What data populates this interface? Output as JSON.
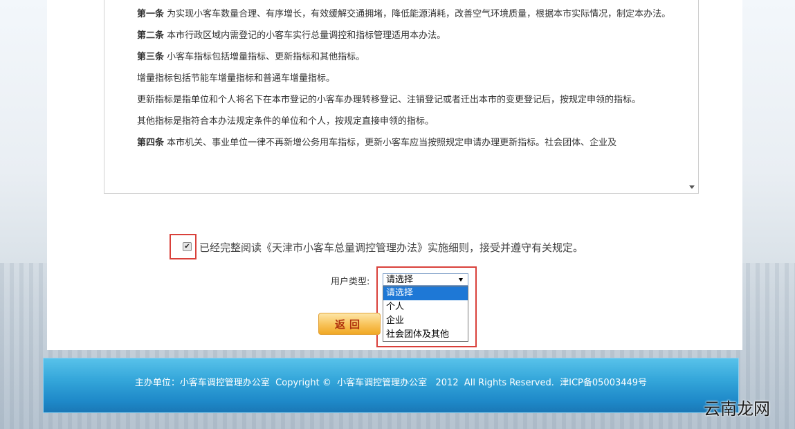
{
  "regulations": {
    "paragraphs": [
      {
        "lead": "第一条",
        "text": " 为实现小客车数量合理、有序增长，有效缓解交通拥堵，降低能源消耗，改善空气环境质量，根据本市实际情况，制定本办法。"
      },
      {
        "lead": "第二条",
        "text": " 本市行政区域内需登记的小客车实行总量调控和指标管理适用本办法。"
      },
      {
        "lead": "第三条",
        "text": " 小客车指标包括增量指标、更新指标和其他指标。"
      },
      {
        "lead": "",
        "text": "增量指标包括节能车增量指标和普通车增量指标。"
      },
      {
        "lead": "",
        "text": "更新指标是指单位和个人将名下在本市登记的小客车办理转移登记、注销登记或者迁出本市的变更登记后，按规定申领的指标。"
      },
      {
        "lead": "",
        "text": "其他指标是指符合本办法规定条件的单位和个人，按规定直接申领的指标。"
      },
      {
        "lead": "第四条",
        "text": " 本市机关、事业单位一律不再新增公务用车指标，更新小客车应当按照规定申请办理更新指标。社会团体、企业及"
      }
    ]
  },
  "agreement": {
    "checked": true,
    "check_glyph": "✔",
    "text": "已经完整阅读《天津市小客车总量调控管理办法》实施细则，接受并遵守有关规定。"
  },
  "user_type": {
    "label": "用户类型:",
    "selected": "请选择",
    "options": [
      "请选择",
      "个人",
      "企业",
      "社会团体及其他"
    ]
  },
  "buttons": {
    "back": "返回"
  },
  "footer": {
    "text": "主办单位：小客车调控管理办公室  Copyright ©  小客车调控管理办公室   2012  All Rights Reserved.  津ICP备05003449号"
  },
  "watermark": "云南龙网",
  "colors": {
    "highlight": "#d9403a",
    "footer_blue": "#2a96d2",
    "option_selected": "#1e78d6"
  }
}
